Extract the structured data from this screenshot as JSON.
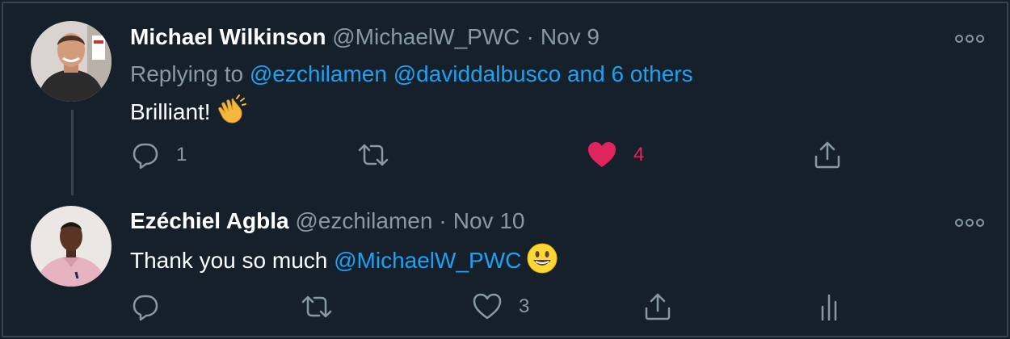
{
  "tweets": [
    {
      "name": "Michael Wilkinson",
      "handle": "@MichaelW_PWC",
      "separator": "·",
      "date": "Nov 9",
      "replying_prefix": "Replying to",
      "replying_mention1": "@ezchilamen",
      "replying_mention2": "@daviddalbusco",
      "replying_others": "and 6 others",
      "text": "Brilliant!",
      "emoji": "clapping-hands-icon",
      "reply_count": "1",
      "retweet_count": "",
      "like_count": "4",
      "liked": true
    },
    {
      "name": "Ezéchiel Agbla",
      "handle": "@ezchilamen",
      "separator": "·",
      "date": "Nov 10",
      "text": "Thank you so much",
      "mention": "@MichaelW_PWC",
      "emoji": "smiley-face-icon",
      "reply_count": "",
      "retweet_count": "",
      "like_count": "3",
      "liked": false
    }
  ],
  "colors": {
    "background": "#15202b",
    "text_primary": "#ffffff",
    "text_secondary": "#8899a6",
    "link": "#1da1f2",
    "like_active": "#e0245e",
    "border": "#38444d"
  }
}
